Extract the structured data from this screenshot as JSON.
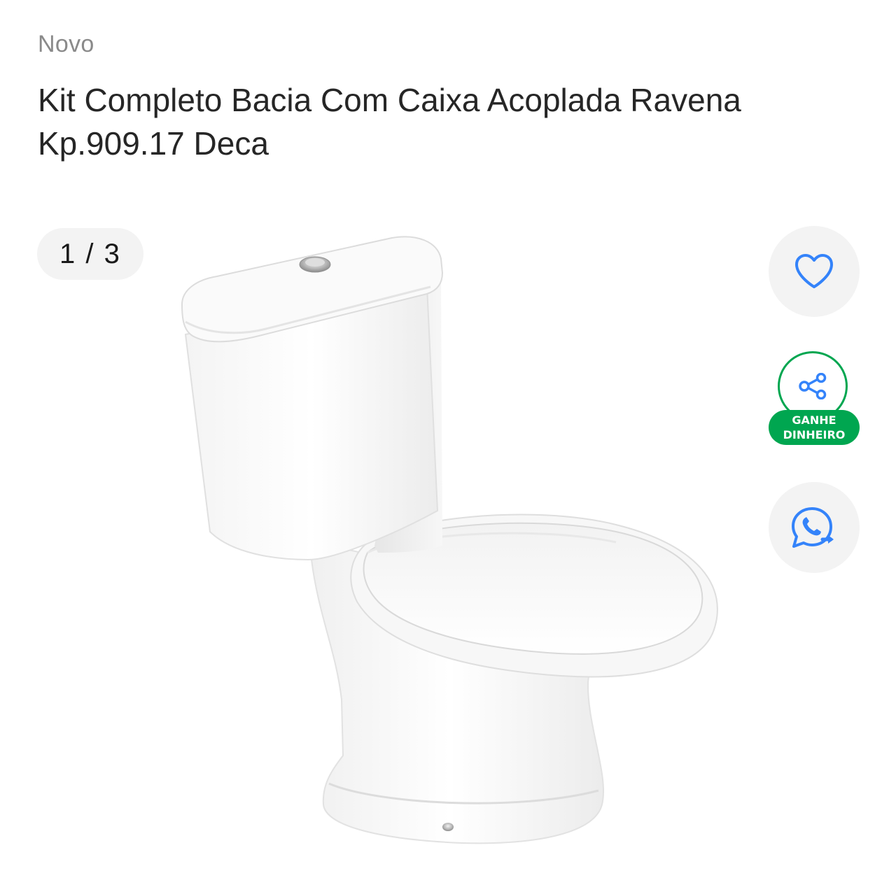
{
  "product": {
    "condition": "Novo",
    "title": "Kit Completo Bacia Com Caixa Acoplada Ravena Kp.909.17 Deca"
  },
  "gallery": {
    "current": "1",
    "separator": " / ",
    "total": "3"
  },
  "actions": {
    "favorite_icon": "heart-icon",
    "share_icon": "share-icon",
    "share_badge_line1": "GANHE",
    "share_badge_line2": "DINHEIRO",
    "whatsapp_icon": "whatsapp-share-icon"
  },
  "colors": {
    "accent_blue": "#3483fa",
    "badge_green": "#00a650",
    "fab_background": "#f3f3f3"
  }
}
